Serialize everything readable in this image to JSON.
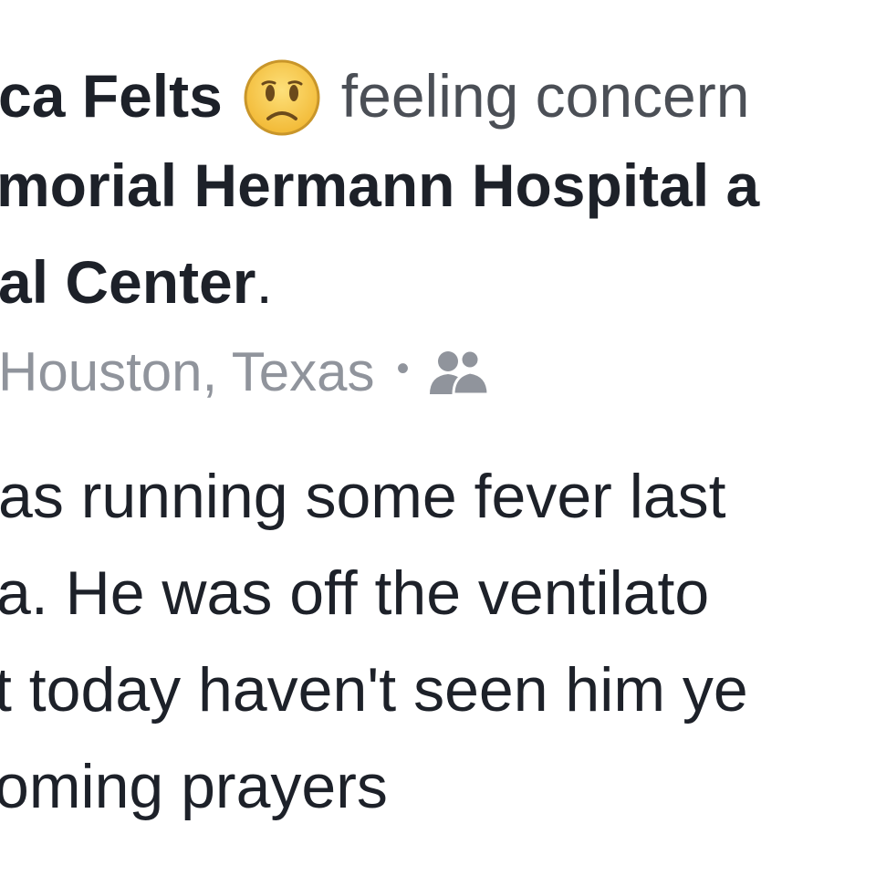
{
  "post": {
    "author_name": "ca Felts",
    "feeling_icon": "sad-emoji-icon",
    "feeling_text": "feeling concern",
    "place_line_1": "morial Hermann Hospital a",
    "place_line_2": "al Center",
    "place_period": ".",
    "location": "Houston, Texas",
    "separator": "•",
    "audience_icon": "friends-icon",
    "body_lines": [
      "as running some fever last",
      "a. He was off the ventilato",
      "t today haven't seen him ye",
      "oming prayers"
    ]
  },
  "colors": {
    "text": "#1d2129",
    "feeling": "#4b4f56",
    "meta": "#90949c",
    "emoji_face": "#f7c544"
  }
}
